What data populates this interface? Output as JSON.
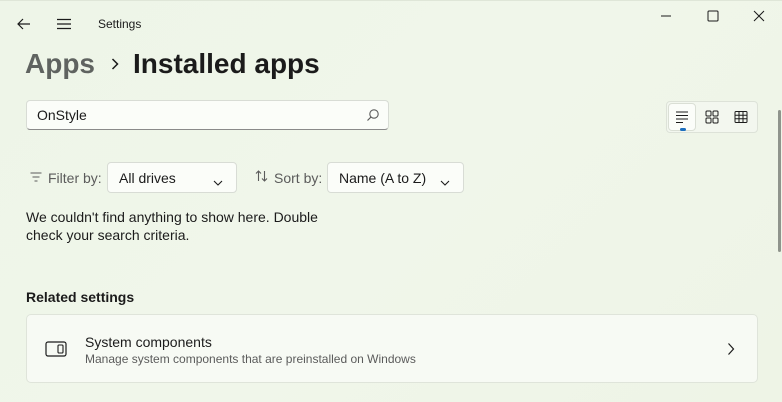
{
  "window": {
    "app_title": "Settings",
    "icons": [
      "back-arrow-icon",
      "hamburger-menu-icon",
      "minimize-icon",
      "maximize-icon",
      "close-icon"
    ]
  },
  "breadcrumb": {
    "parent": "Apps",
    "separator_icon": "chevron-right-icon",
    "current": "Installed apps"
  },
  "search": {
    "value": "OnStyle",
    "placeholder": "",
    "icon": "search-icon"
  },
  "view_options": {
    "items": [
      {
        "name": "list-view",
        "icon": "list-view-icon",
        "active": true
      },
      {
        "name": "grid-view",
        "icon": "grid-view-icon",
        "active": false
      },
      {
        "name": "tile-view",
        "icon": "tile-view-icon",
        "active": false
      }
    ],
    "accent_color": "#1c6fbf"
  },
  "filters": {
    "filter_label": "Filter by:",
    "filter_value": "All drives",
    "sort_label": "Sort by:",
    "sort_value": "Name (A to Z)"
  },
  "empty_state": {
    "message": "We couldn't find anything to show here. Double check your search criteria."
  },
  "related": {
    "title": "Related settings",
    "items": [
      {
        "title": "System components",
        "description": "Manage system components that are preinstalled on Windows",
        "icon": "system-components-icon"
      }
    ]
  }
}
